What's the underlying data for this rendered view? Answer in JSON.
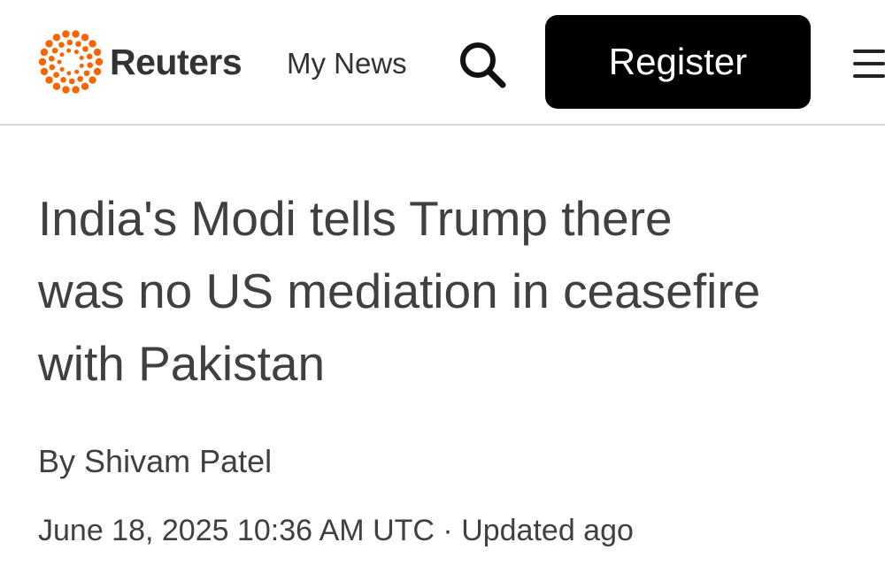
{
  "header": {
    "brand": "Reuters",
    "my_news_label": "My News",
    "register_label": "Register",
    "icons": {
      "logo": "reuters-dot-logo-icon",
      "search": "search-icon",
      "menu": "hamburger-menu-icon"
    },
    "colors": {
      "logo_orange": "#fa6400",
      "register_bg": "#000000",
      "register_text": "#ffffff"
    }
  },
  "article": {
    "headline_lines": [
      "India's Modi tells Trump there",
      "was no US mediation in ceasefire",
      "with Pakistan"
    ],
    "byline_prefix": "By",
    "author": "Shivam Patel",
    "published": "June 18, 2025 10:36 AM UTC",
    "separator": "·",
    "updated": "Updated ago"
  }
}
